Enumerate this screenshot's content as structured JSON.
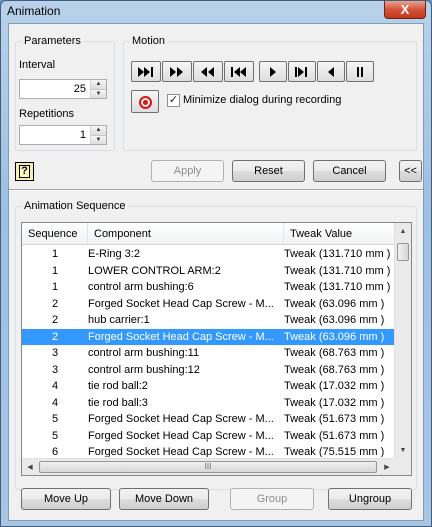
{
  "window": {
    "title": "Animation",
    "close_glyph": "X"
  },
  "parameters": {
    "group_label": "Parameters",
    "interval_label": "Interval",
    "interval_value": "25",
    "repetitions_label": "Repetitions",
    "repetitions_value": "1"
  },
  "motion": {
    "group_label": "Motion",
    "buttons": [
      {
        "name": "play-to-end",
        "icon": "skip-forward-end-icon"
      },
      {
        "name": "fast-forward",
        "icon": "fast-forward-icon"
      },
      {
        "name": "fast-reverse",
        "icon": "fast-reverse-icon"
      },
      {
        "name": "skip-to-start",
        "icon": "skip-to-start-icon"
      },
      {
        "name": "play-forward",
        "icon": "play-forward-icon"
      },
      {
        "name": "step-forward",
        "icon": "step-forward-icon"
      },
      {
        "name": "play-reverse",
        "icon": "play-reverse-icon"
      },
      {
        "name": "pause",
        "icon": "pause-icon"
      }
    ],
    "record_icon": "record-icon",
    "minimize_label": "Minimize dialog during recording",
    "minimize_checked": true
  },
  "actions": {
    "help_glyph": "?",
    "apply_label": "Apply",
    "reset_label": "Reset",
    "cancel_label": "Cancel",
    "collapse_label": "<<"
  },
  "sequence": {
    "group_label": "Animation Sequence",
    "columns": [
      "Sequence",
      "Component",
      "Tweak Value"
    ],
    "rows": [
      {
        "seq": "1",
        "component": "E-Ring 3:2",
        "tweak": "Tweak (131.710 mm )"
      },
      {
        "seq": "1",
        "component": "LOWER CONTROL ARM:2",
        "tweak": "Tweak (131.710 mm )"
      },
      {
        "seq": "1",
        "component": "control arm bushing:6",
        "tweak": "Tweak (131.710 mm )"
      },
      {
        "seq": "2",
        "component": "Forged Socket Head Cap Screw - M...",
        "tweak": "Tweak (63.096 mm )"
      },
      {
        "seq": "2",
        "component": "hub carrier:1",
        "tweak": "Tweak (63.096 mm )"
      },
      {
        "seq": "2",
        "component": "Forged Socket Head Cap Screw - M...",
        "tweak": "Tweak (63.096 mm )",
        "selected": true
      },
      {
        "seq": "3",
        "component": "control arm bushing:11",
        "tweak": "Tweak (68.763 mm )"
      },
      {
        "seq": "3",
        "component": "control arm bushing:12",
        "tweak": "Tweak (68.763 mm )"
      },
      {
        "seq": "4",
        "component": "tie rod ball:2",
        "tweak": "Tweak (17.032 mm )"
      },
      {
        "seq": "4",
        "component": "tie rod ball:3",
        "tweak": "Tweak (17.032 mm )"
      },
      {
        "seq": "5",
        "component": "Forged Socket Head Cap Screw - M...",
        "tweak": "Tweak (51.673 mm )"
      },
      {
        "seq": "5",
        "component": "Forged Socket Head Cap Screw - M...",
        "tweak": "Tweak (51.673 mm )"
      },
      {
        "seq": "6",
        "component": "Forged Socket Head Cap Screw - M...",
        "tweak": "Tweak (75.515 mm )"
      }
    ],
    "hscroll_grip": "III"
  },
  "bottom_buttons": {
    "move_up": "Move Up",
    "move_down": "Move Down",
    "group": "Group",
    "ungroup": "Ungroup"
  },
  "colors": {
    "selection": "#3399ff",
    "record": "#d01818",
    "close": "#c4381d"
  }
}
